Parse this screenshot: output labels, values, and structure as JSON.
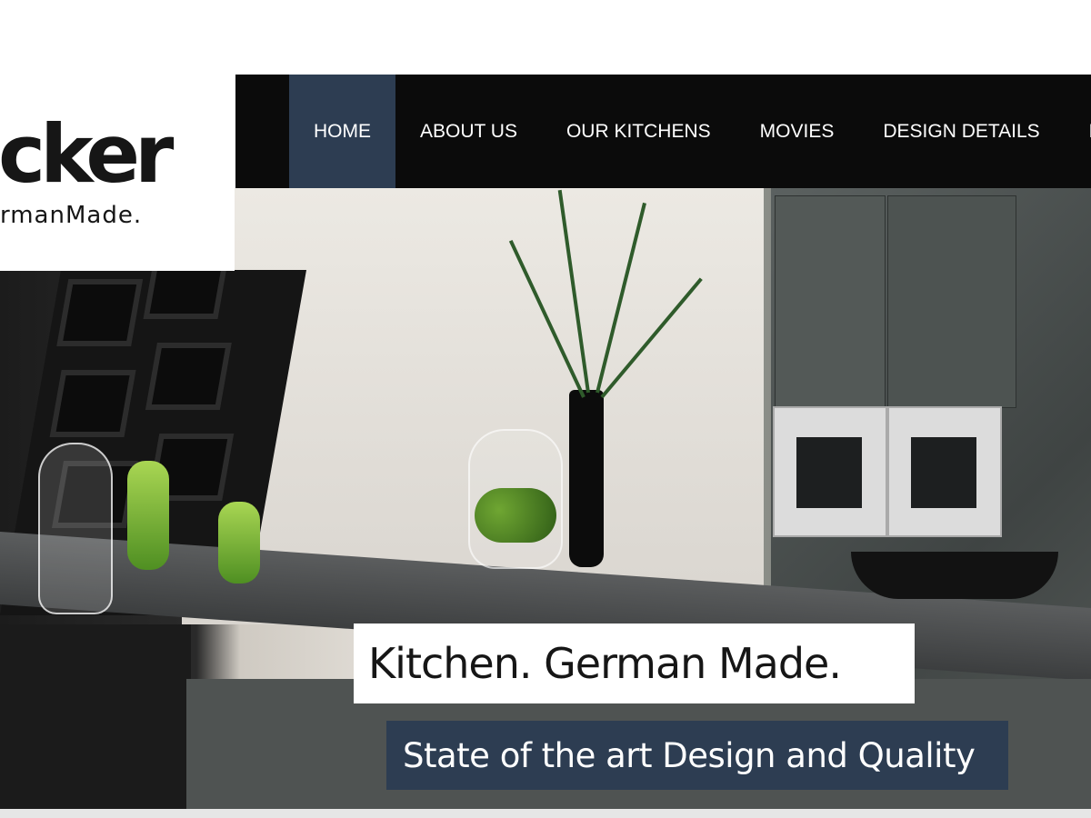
{
  "logo": {
    "brand": "cker",
    "tagline": "rmanMade."
  },
  "nav": {
    "items": [
      {
        "label": "HOME",
        "active": true
      },
      {
        "label": "ABOUT US",
        "active": false
      },
      {
        "label": "OUR KITCHENS",
        "active": false
      },
      {
        "label": "MOVIES",
        "active": false
      },
      {
        "label": "DESIGN DETAILS",
        "active": false
      },
      {
        "label": "HO",
        "active": false
      }
    ]
  },
  "hero": {
    "headline": "Kitchen. German Made.",
    "subline": "State of the art Design and Quality"
  },
  "colors": {
    "nav_bg": "#0b0b0b",
    "accent": "#2d3d52",
    "text_dark": "#161616"
  }
}
